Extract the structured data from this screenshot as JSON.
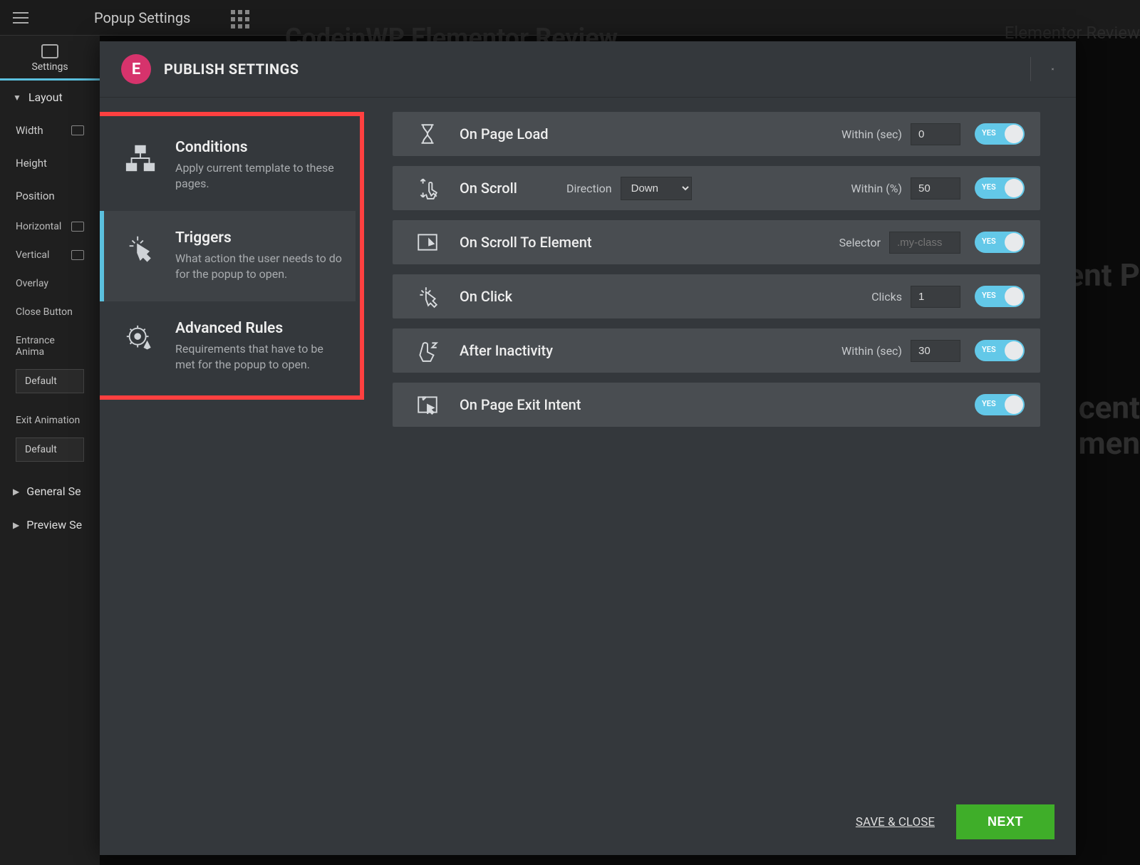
{
  "topbar": {
    "title": "Popup Settings"
  },
  "bg": {
    "page_title": "CodeinWP Elementor Review",
    "crumb": "Elementor Review",
    "recent": "cent P",
    "recent2": "cent",
    "recent3": "men"
  },
  "sidepanel": {
    "tab": "Settings",
    "layout": "Layout",
    "width": "Width",
    "height": "Height",
    "position": "Position",
    "horizontal": "Horizontal",
    "vertical": "Vertical",
    "overlay": "Overlay",
    "close_button": "Close Button",
    "entrance_anim": "Entrance Anima",
    "entrance_anim_val": "Default",
    "exit_anim": "Exit Animation",
    "exit_anim_val": "Default",
    "general": "General Se",
    "preview": "Preview Se"
  },
  "modal": {
    "title": "PUBLISH SETTINGS",
    "save_close": "SAVE & CLOSE",
    "next": "NEXT"
  },
  "nav": {
    "conditions": {
      "title": "Conditions",
      "desc": "Apply current template to these pages."
    },
    "triggers": {
      "title": "Triggers",
      "desc": "What action the user needs to do for the popup to open."
    },
    "advanced": {
      "title": "Advanced Rules",
      "desc": "Requirements that have to be met for the popup to open."
    }
  },
  "triggers": {
    "page_load": {
      "name": "On Page Load",
      "within_label": "Within (sec)",
      "within_val": "0"
    },
    "scroll": {
      "name": "On Scroll",
      "direction_label": "Direction",
      "direction_val": "Down",
      "within_label": "Within (%)",
      "within_val": "50"
    },
    "scroll_elem": {
      "name": "On Scroll To Element",
      "selector_label": "Selector",
      "selector_placeholder": ".my-class"
    },
    "click": {
      "name": "On Click",
      "clicks_label": "Clicks",
      "clicks_val": "1"
    },
    "inactivity": {
      "name": "After Inactivity",
      "within_label": "Within (sec)",
      "within_val": "30"
    },
    "exit": {
      "name": "On Page Exit Intent"
    },
    "yes": "YES"
  }
}
